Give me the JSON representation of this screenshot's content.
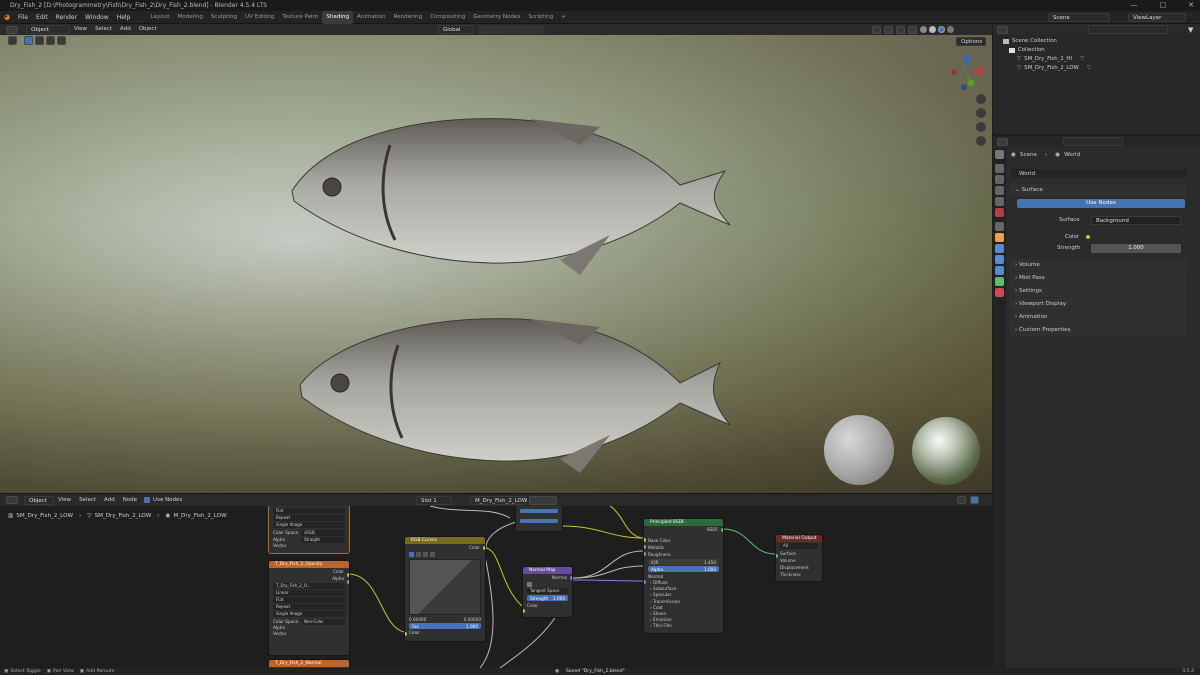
{
  "window": {
    "title": "Dry_Fish_2 [D:\\Photogrammetry\\Fish\\Dry_Fish_2\\Dry_Fish_2.blend] - Blender 4.5.4 LTS"
  },
  "menu": [
    "File",
    "Edit",
    "Render",
    "Window",
    "Help"
  ],
  "workspaces": [
    "Layout",
    "Modeling",
    "Sculpting",
    "UV Editing",
    "Texture Paint",
    "Shading",
    "Animation",
    "Rendering",
    "Compositing",
    "Geometry Nodes",
    "Scripting"
  ],
  "active_workspace": "Shading",
  "scene": {
    "name": "Scene",
    "view_layer": "ViewLayer"
  },
  "viewport": {
    "mode": "Object Mode",
    "menus": [
      "View",
      "Select",
      "Add",
      "Object"
    ],
    "transform": "Global",
    "options": "Options"
  },
  "outliner": {
    "root": "Scene Collection",
    "collection": "Collection",
    "items": [
      "SM_Dry_Fish_2_HI",
      "SM_Dry_Fish_2_LOW"
    ]
  },
  "properties": {
    "breadcrumb": [
      "Scene",
      "World"
    ],
    "world_name": "World",
    "surface_header": "Surface",
    "use_nodes": "Use Nodes",
    "surface_label": "Surface",
    "surface_value": "Background",
    "color_label": "Color",
    "strength_label": "Strength",
    "strength_value": "1.000",
    "panels": [
      "Volume",
      "Mist Pass",
      "Settings",
      "Viewport Display",
      "Animation",
      "Custom Properties"
    ]
  },
  "node_editor": {
    "type": "Object",
    "menus": [
      "View",
      "Select",
      "Add",
      "Node"
    ],
    "use_nodes": "Use Nodes",
    "slot": "Slot 1",
    "material": "M_Dry_Fish_2_LOW",
    "breadcrumb": [
      "SM_Dry_Fish_2_LOW",
      "SM_Dry_Fish_2_LOW",
      "M_Dry_Fish_2_LOW"
    ],
    "nodes": {
      "tex1": {
        "rows": [
          "Flat",
          "Repeat",
          "Single Image",
          "sRGB",
          "Straight"
        ],
        "labels": [
          "Color Space",
          "Alpha",
          "Vector"
        ]
      },
      "tex2": {
        "title": "T_Dry_Fish_2_Opacity",
        "outs": [
          "Color",
          "Alpha"
        ],
        "file": "T_Dry_Fish_2_O...",
        "rows": [
          "Linear",
          "Flat",
          "Repeat",
          "Single Image",
          "Non-Color"
        ],
        "labels": [
          "Color Space",
          "Alpha",
          "Vector"
        ]
      },
      "tex3": {
        "title": "T_Dry_Fish_2_Normal"
      },
      "curves": {
        "title": "RGB Curves",
        "out": "Color",
        "fac": "Fac",
        "in": "Color",
        "c1": "0.00000",
        "c2": "0.00000",
        "facval": "1.000"
      },
      "normal": {
        "title": "Normal Map",
        "out": "Normal",
        "space": "Tangent Space",
        "strength": "Strength",
        "strength_val": "1.000",
        "in": "Color"
      },
      "bsdf": {
        "title": "Principled BSDF",
        "out": "BSDF",
        "rows": [
          "Base Color",
          "Metallic",
          "Roughness",
          "IOR",
          "Alpha",
          "Normal"
        ],
        "ior": "1.450",
        "alpha": "1.000",
        "subs": [
          "Diffuse",
          "Subsurface",
          "Specular",
          "Transmission",
          "Coat",
          "Sheen",
          "Emission",
          "Thin Film"
        ]
      },
      "output": {
        "title": "Material Output",
        "target": "All",
        "rows": [
          "Surface",
          "Volume",
          "Displacement",
          "Thickness"
        ]
      }
    }
  },
  "statusbar": {
    "left": [
      "Select Toggle",
      "Pan View",
      "Add Reroute"
    ],
    "message": "Saved \"Dry_Fish_2.blend\"",
    "version": "4.5.4"
  },
  "colors": {
    "accent": "#4772b3",
    "green_node": "#2a6b3a",
    "red_node": "#6b2a2a",
    "tex_node": "#b9652c",
    "curves_node": "#7a6a1e",
    "normal_node": "#6a4aa0"
  }
}
